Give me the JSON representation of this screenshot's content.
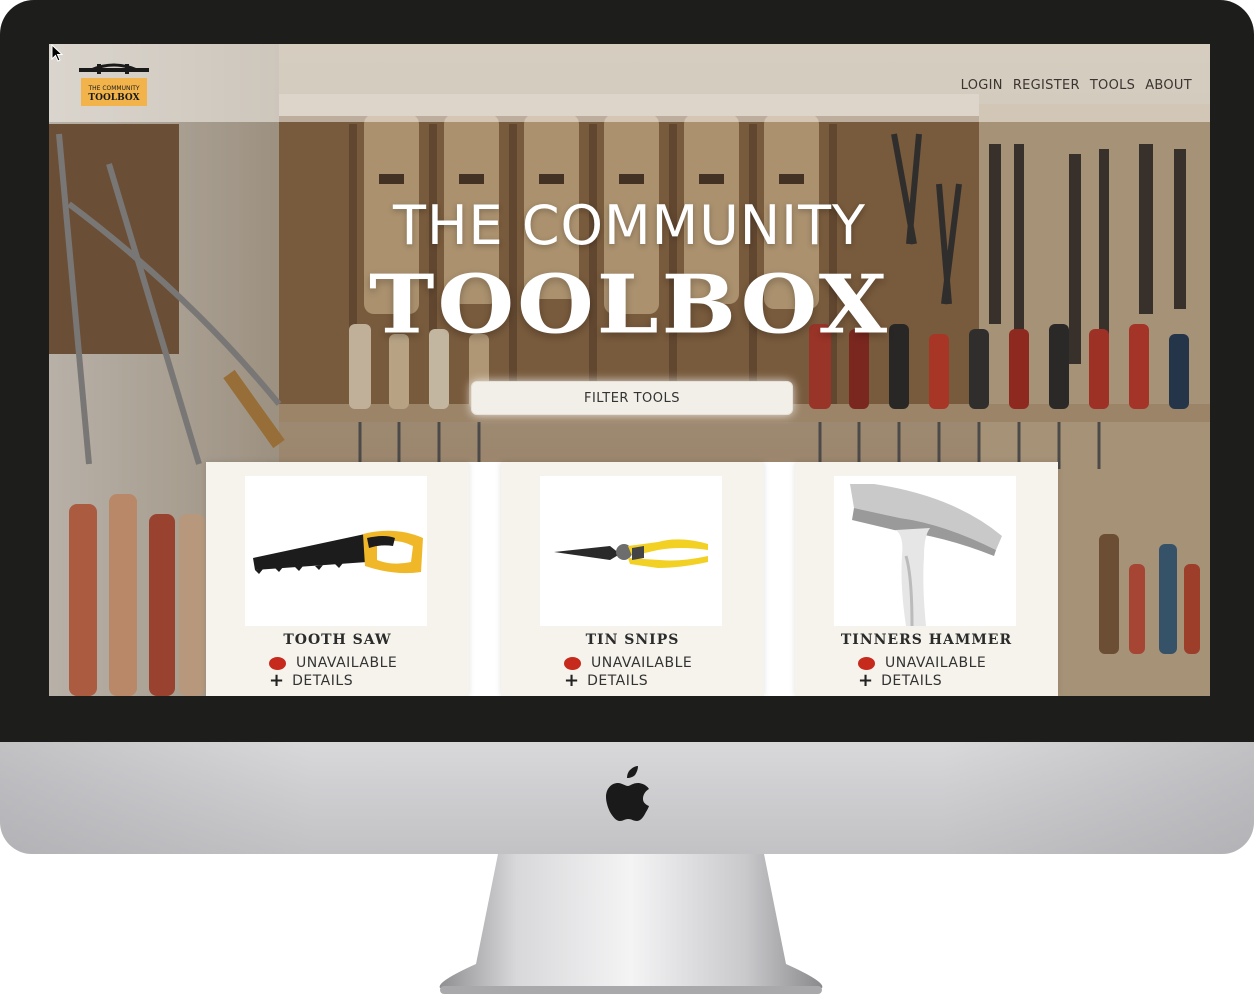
{
  "nav": {
    "logo_line1": "THE COMMUNITY",
    "logo_line2": "TOOLBOX",
    "links": [
      "LOGIN",
      "REGISTER",
      "TOOLS",
      "ABOUT"
    ]
  },
  "hero": {
    "subtitle": "THE COMMUNITY",
    "title": "TOOLBOX",
    "filter_button": "FILTER TOOLS"
  },
  "tools": [
    {
      "name": "TOOTH SAW",
      "status": "UNAVAILABLE",
      "details": "DETAILS",
      "icon": "saw-icon"
    },
    {
      "name": "TIN SNIPS",
      "status": "UNAVAILABLE",
      "details": "DETAILS",
      "icon": "tin-snips-icon"
    },
    {
      "name": "TINNERS HAMMER",
      "status": "UNAVAILABLE",
      "details": "DETAILS",
      "icon": "hammer-icon"
    }
  ],
  "colors": {
    "status_unavailable": "#c62a1c",
    "logo_accent": "#f2b44a"
  }
}
